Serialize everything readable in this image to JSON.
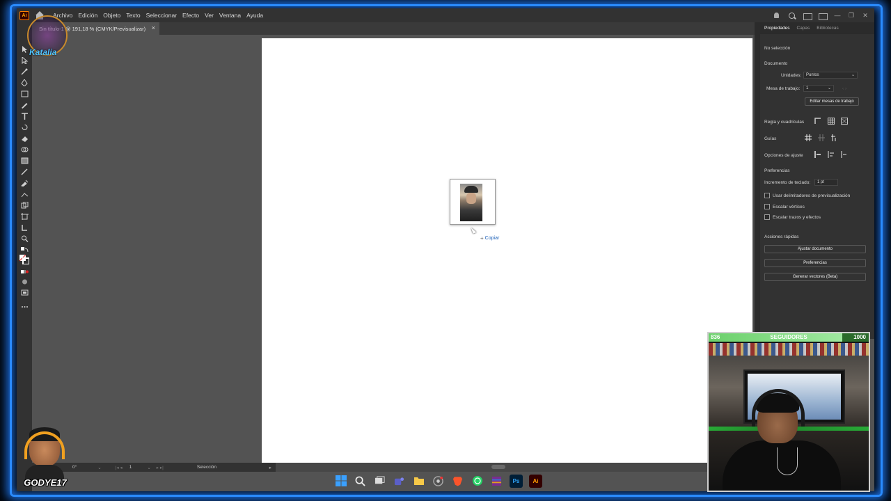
{
  "app": {
    "logo_text": "Ai",
    "menus": [
      "Archivo",
      "Edición",
      "Objeto",
      "Texto",
      "Seleccionar",
      "Efecto",
      "Ver",
      "Ventana",
      "Ayuda"
    ]
  },
  "document_tab": {
    "title": "Sin título-1 @ 191,18 % (CMYK/Previsualizar)",
    "close": "×"
  },
  "canvas": {
    "tooltip_plus": "+",
    "tooltip": "Copiar"
  },
  "statusbar": {
    "rotation": "0°",
    "artboard": "1",
    "tool": "Selección"
  },
  "panel": {
    "tabs": [
      "Propiedades",
      "Capas",
      "Bibliotecas"
    ],
    "no_selection": "No selección",
    "document_heading": "Documento",
    "units_label": "Unidades:",
    "units_value": "Puntos",
    "artboard_label": "Mesa de trabajo:",
    "artboard_value": "1",
    "edit_artboards_button": "Editar mesas de trabajo",
    "rulers_grids_label": "Regla y cuadrículas",
    "guides_label": "Guías",
    "snap_label": "Opciones de ajuste",
    "preferences_heading": "Preferencias",
    "keyboard_increment_label": "Incremento de teclado:",
    "keyboard_increment_value": "1 pt",
    "preview_bounds_label": "Usar delimitadores de previsualización",
    "scale_corners_label": "Escalar vértices",
    "scale_strokes_label": "Escalar trazos y efectos",
    "quick_actions_heading": "Acciones rápidas",
    "fit_document_button": "Ajustar documento",
    "preferences_button": "Preferencias",
    "generate_vectors_button": "Generar vectores (Beta)"
  },
  "followers": {
    "current": "836",
    "label": "SEGUIDORES",
    "goal": "1000",
    "progress": 0.836
  },
  "watermark": {
    "text": "Katalia"
  },
  "streamer": {
    "name": "GODYE17"
  },
  "taskbar": {
    "photoshop_label": "Ps",
    "illustrator_label": "Ai"
  },
  "colors": {
    "neon_border": "#2a8bff",
    "panel_bg": "#323232",
    "canvas_bg": "#535353",
    "artboard": "#ffffff",
    "ai_orange": "#ff9a00",
    "follow_green": "#6bd06b"
  }
}
